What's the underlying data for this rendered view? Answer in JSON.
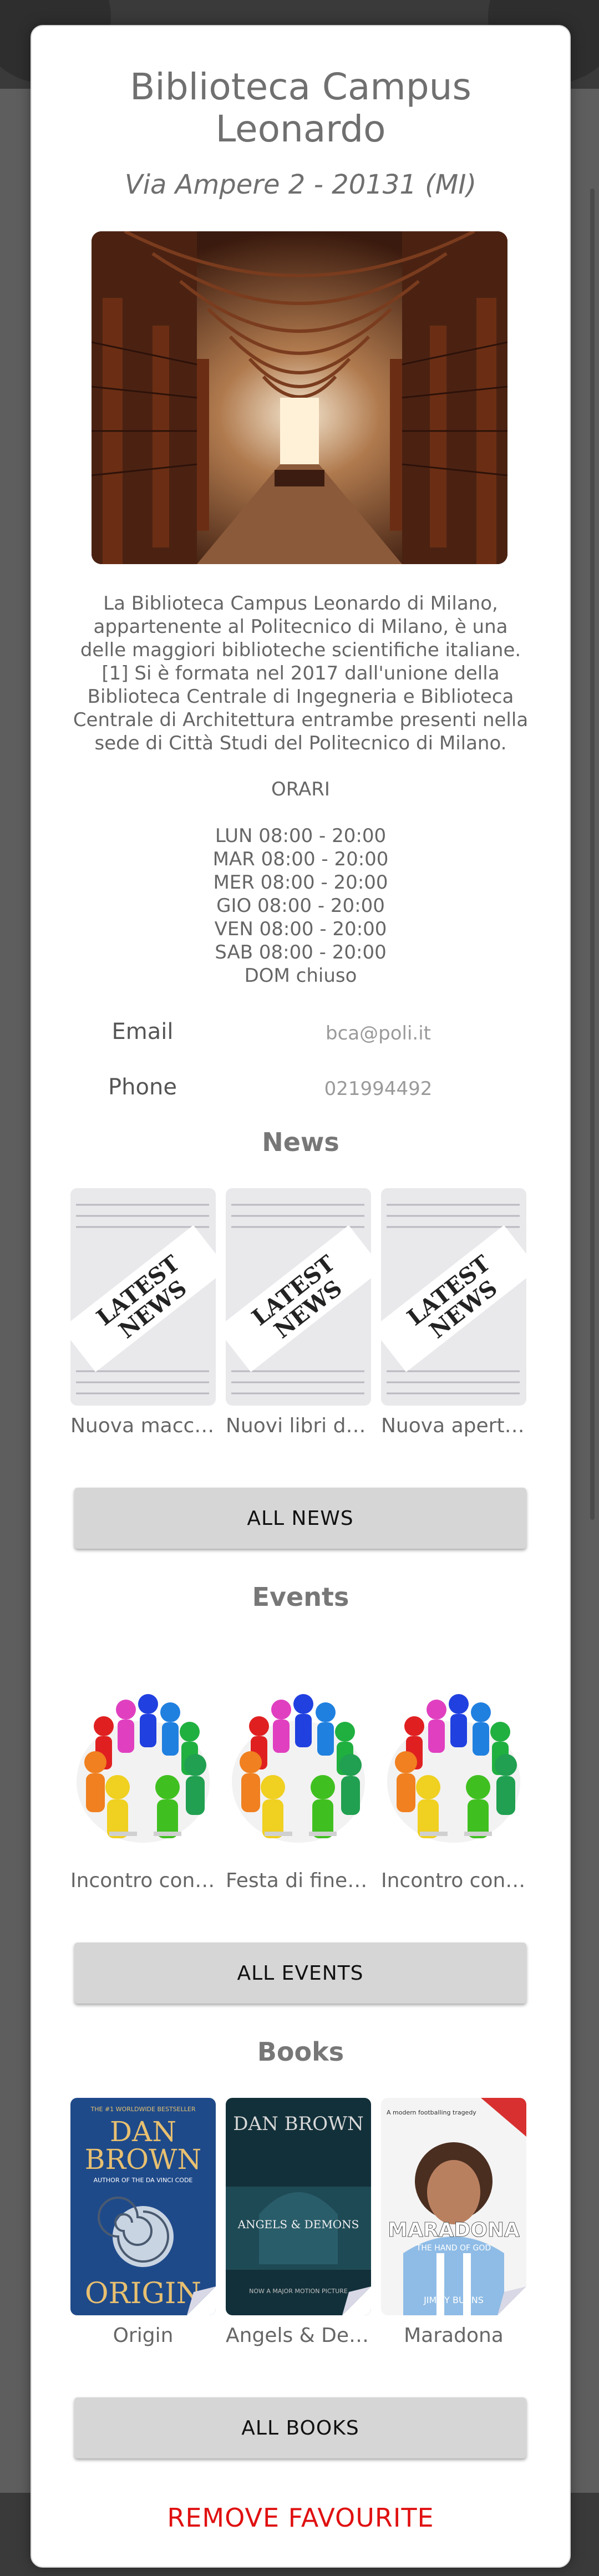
{
  "library": {
    "name": "Biblioteca Campus Leonardo",
    "address": "Via Ampere 2 - 20131 (MI)",
    "description": "La Biblioteca Campus Leonardo di Milano, appartenente al Politecnico di Milano, è una delle maggiori biblioteche scientifiche italiane.[1] Si è formata nel 2017 dall'unione della Biblioteca Centrale di Ingegneria e Biblioteca Centrale di Architettura entrambe presenti nella sede di Città Studi del Politecnico di Milano."
  },
  "hours": {
    "heading": "ORARI",
    "days": [
      "LUN 08:00 - 20:00",
      "MAR 08:00 - 20:00",
      "MER 08:00 - 20:00",
      "GIO 08:00 - 20:00",
      "VEN 08:00 - 20:00",
      "SAB 08:00 - 20:00",
      "DOM chiuso"
    ]
  },
  "contact": {
    "email_label": "Email",
    "email_value": "bca@poli.it",
    "phone_label": "Phone",
    "phone_value": "021994492"
  },
  "news": {
    "title": "News",
    "image_text": [
      "LATEST",
      "NEWS"
    ],
    "items": [
      "Nuova macchi...",
      "Nuovi libri dis...",
      "Nuova apertura"
    ],
    "button": "ALL NEWS"
  },
  "events": {
    "title": "Events",
    "items": [
      "Incontro con a...",
      "Festa di fine a...",
      "Incontro con a..."
    ],
    "button": "ALL EVENTS"
  },
  "books": {
    "title": "Books",
    "items": [
      "Origin",
      "Angels & Dem...",
      "Maradona"
    ],
    "button": "ALL BOOKS",
    "covers": [
      {
        "top": "THE #1 WORLDWIDE BESTSELLER",
        "author1": "DAN",
        "author2": "BROWN",
        "sub": "AUTHOR OF THE DA VINCI CODE",
        "title": "ORIGIN"
      },
      {
        "author": "DAN BROWN",
        "title": "ANGELS & DEMONS",
        "footer": "NOW A MAJOR MOTION PICTURE"
      },
      {
        "tag": "A modern footballing tragedy",
        "title": "MARADONA",
        "sub": "THE HAND OF GOD",
        "author": "JIMMY BURNS"
      }
    ]
  },
  "actions": {
    "remove_favourite": "REMOVE FAVOURITE"
  },
  "colors": {
    "accent_red": "#e01010",
    "button_gray": "#d6d6d6",
    "text_gray": "#666666"
  }
}
